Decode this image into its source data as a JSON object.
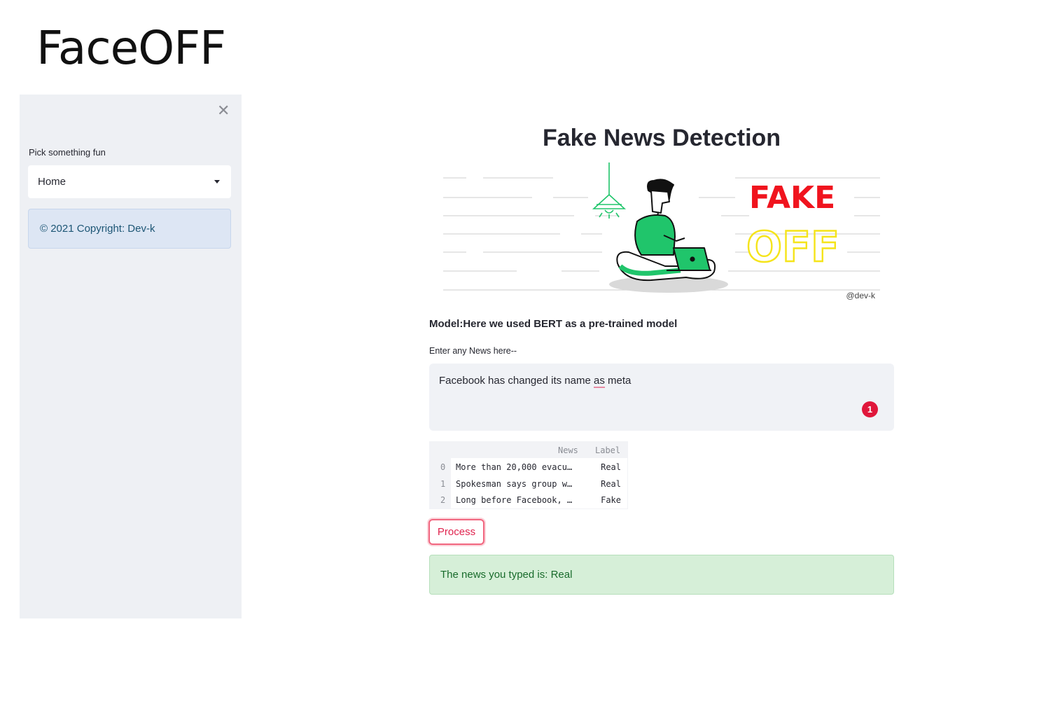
{
  "brand": {
    "title": "FaceOFF"
  },
  "sidebar": {
    "close_glyph": "✕",
    "select_label": "Pick something fun",
    "select_value": "Home",
    "copyright": "© 2021 Copyright: Dev-k"
  },
  "main": {
    "title": "Fake News Detection",
    "hero": {
      "fake_text": "FAKE",
      "off_text": "OFF",
      "credit": "@dev-k",
      "colors": {
        "fake": "#f0141e",
        "off": "#f5e41b",
        "person": "#20c56b"
      }
    },
    "model_line": "Model:Here we used BERT as a pre-trained model",
    "input_label": "Enter any News here--",
    "input": {
      "text_before": "Facebook has changed its name ",
      "text_marked": "as",
      "text_after": " meta",
      "badge": "1"
    },
    "table": {
      "headers": [
        "News",
        "Label"
      ],
      "rows": [
        {
          "idx": "0",
          "news": "More than 20,000 evacu…",
          "label": "Real"
        },
        {
          "idx": "1",
          "news": "Spokesman says group w…",
          "label": "Real"
        },
        {
          "idx": "2",
          "news": "Long before Facebook, …",
          "label": "Fake"
        }
      ]
    },
    "process_label": "Process",
    "result_text": "The news you typed is: Real"
  },
  "colors": {
    "sidebar_bg": "#eef0f4",
    "accent": "#e0234e",
    "success_bg": "#d6efd8",
    "info_bg": "#dde6f4"
  }
}
